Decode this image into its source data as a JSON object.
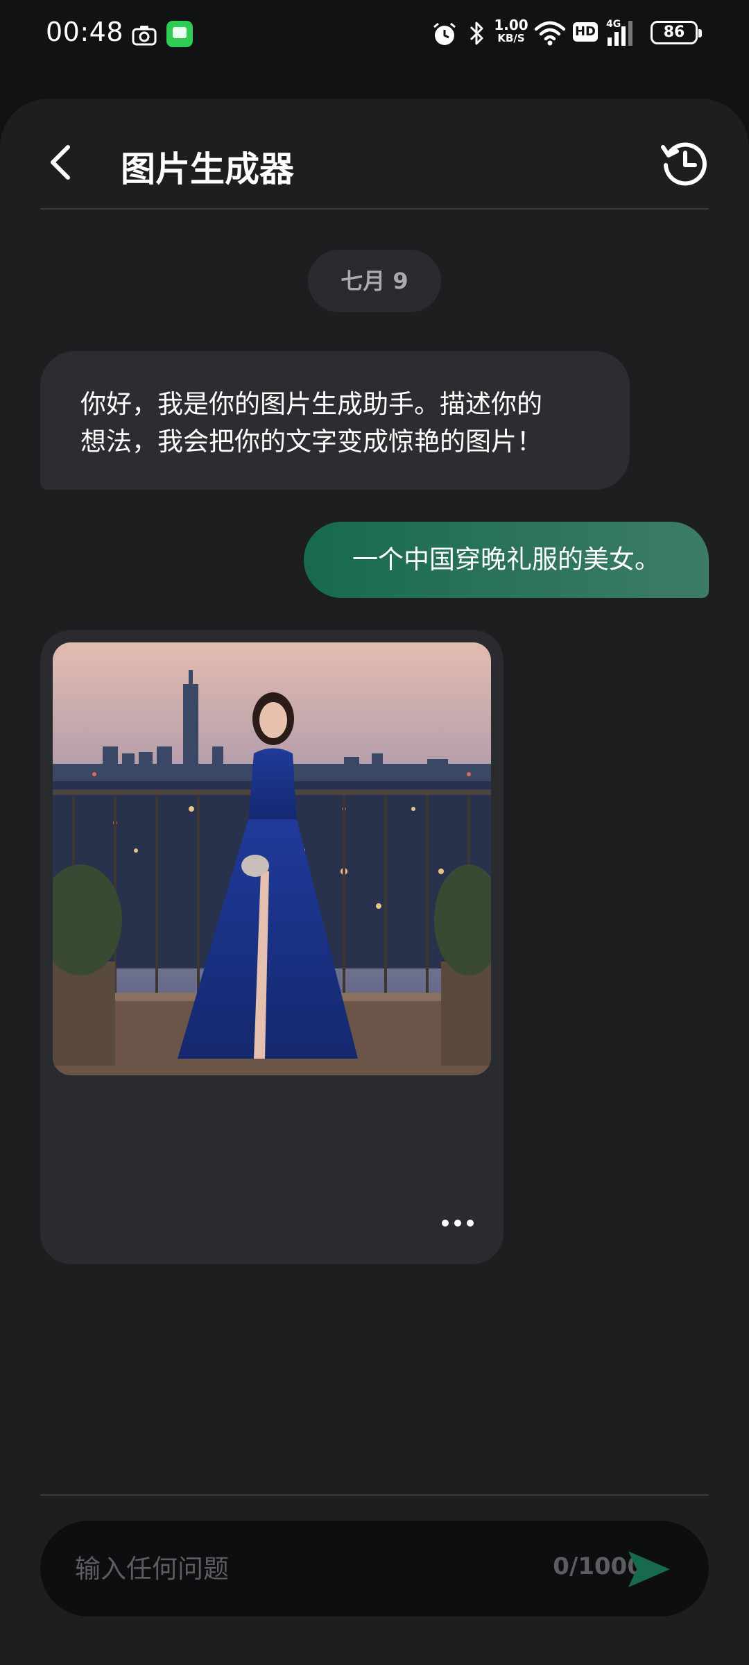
{
  "status_bar": {
    "time": "00:48",
    "speed_value": "1.00",
    "speed_unit": "KB/S",
    "hd_label": "HD",
    "network_label": "4G",
    "battery": "86",
    "icons": [
      "camera-icon",
      "message-app-icon",
      "alarm-icon",
      "bluetooth-icon",
      "wifi-icon",
      "hd-icon",
      "signal-icon",
      "battery-icon"
    ]
  },
  "header": {
    "title": "图片生成器",
    "back_icon": "chevron-left-icon",
    "history_icon": "history-icon"
  },
  "chat": {
    "date_label": "七月 9",
    "bot_message_line1": "你好，我是你的图片生成助手。描述你的",
    "bot_message_line2": "想法，我会把你的文字变成惊艳的图片！",
    "user_message": "一个中国穿晚礼服的美女。",
    "image_more_icon": "more-dots-icon"
  },
  "composer": {
    "placeholder": "输入任何问题",
    "value": "",
    "char_count": "0/1000",
    "send_icon": "send-icon"
  },
  "colors": {
    "accent": "#176a4e",
    "sheet_bg": "#1d1e20",
    "bubble_bg": "#2c2d30"
  }
}
